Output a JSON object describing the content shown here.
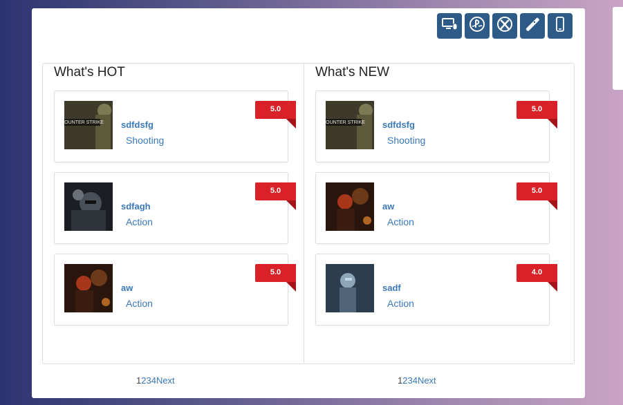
{
  "platform_bar": {
    "buttons": [
      {
        "name": "pc-button",
        "icon": "computer-mouse-icon"
      },
      {
        "name": "playstation-button",
        "icon": "playstation-icon"
      },
      {
        "name": "xbox-button",
        "icon": "xbox-icon"
      },
      {
        "name": "wii-button",
        "icon": "wii-remote-icon"
      },
      {
        "name": "mobile-button",
        "icon": "mobile-phone-icon"
      }
    ],
    "color": "#2e5a88"
  },
  "hot": {
    "title": "What's HOT",
    "games": [
      {
        "name": "sdfdsfg",
        "genre": "Shooting",
        "rating": "5.0",
        "thumb": "counter-strike"
      },
      {
        "name": "sdfagh",
        "genre": "Action",
        "rating": "5.0",
        "thumb": "dark-soldier"
      },
      {
        "name": "aw",
        "genre": "Action",
        "rating": "5.0",
        "thumb": "red-hair-warrior"
      }
    ],
    "pagination": {
      "pages": [
        "1",
        "2",
        "3",
        "4"
      ],
      "next": "Next",
      "current": "1"
    }
  },
  "new": {
    "title": "What's NEW",
    "games": [
      {
        "name": "sdfdsfg",
        "genre": "Shooting",
        "rating": "5.0",
        "thumb": "counter-strike"
      },
      {
        "name": "aw",
        "genre": "Action",
        "rating": "5.0",
        "thumb": "red-hair-warrior"
      },
      {
        "name": "sadf",
        "genre": "Action",
        "rating": "4.0",
        "thumb": "crysis-suit"
      }
    ],
    "pagination": {
      "pages": [
        "1",
        "2",
        "3",
        "4"
      ],
      "next": "Next",
      "current": "1"
    }
  },
  "colors": {
    "rating_badge": "#d92228",
    "link": "#3a78b8"
  }
}
